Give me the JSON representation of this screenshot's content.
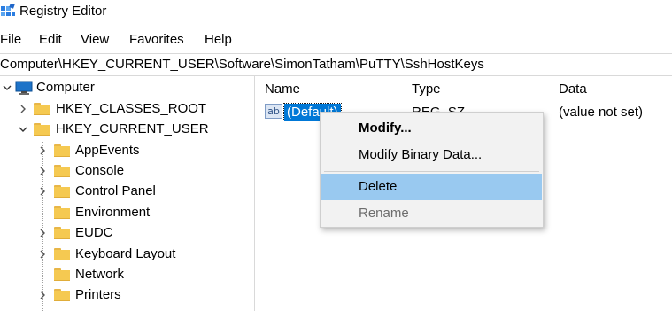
{
  "window": {
    "title": "Registry Editor"
  },
  "menu": [
    "File",
    "Edit",
    "View",
    "Favorites",
    "Help"
  ],
  "address": "Computer\\HKEY_CURRENT_USER\\Software\\SimonTatham\\PuTTY\\SshHostKeys",
  "tree": {
    "root": "Computer",
    "hives": [
      "HKEY_CLASSES_ROOT",
      "HKEY_CURRENT_USER"
    ],
    "children": [
      "AppEvents",
      "Console",
      "Control Panel",
      "Environment",
      "EUDC",
      "Keyboard Layout",
      "Network",
      "Printers"
    ]
  },
  "list": {
    "columns": [
      "Name",
      "Type",
      "Data"
    ],
    "rows": [
      {
        "icon": "ab",
        "name": "(Default)",
        "type": "REG_SZ",
        "data": "(value not set)"
      }
    ]
  },
  "context_menu": {
    "items": [
      "Modify...",
      "Modify Binary Data...",
      "Delete",
      "Rename"
    ],
    "highlighted": "Delete",
    "disabled": "Rename"
  },
  "colors": {
    "selection": "#0078d7",
    "menu_highlight": "#99c9f0",
    "menu_bg": "#f2f2f2",
    "folder": "#f5c951",
    "disabled_text": "#6d6d6d"
  }
}
